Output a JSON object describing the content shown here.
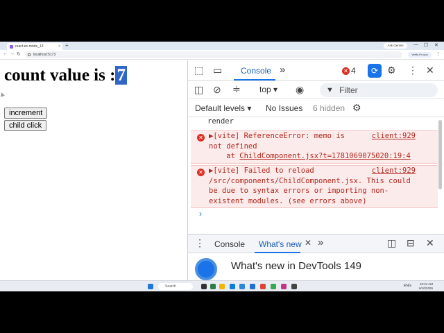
{
  "browser": {
    "tab_title": "react-ex-mode_13",
    "tab_close": "×",
    "new_tab": "+",
    "url": "localhost:5173",
    "ask_label": "Ask Gemini",
    "verify_label": "Verify it's you",
    "win_min": "—",
    "win_max": "☐",
    "win_close": "✕",
    "nav_back": "←",
    "nav_fwd": "→",
    "nav_reload": "↻",
    "menu": "⋮"
  },
  "page": {
    "count_prefix": "count value is :",
    "count_value": "7",
    "increment_label": "increment",
    "child_click_label": "child click"
  },
  "devtools": {
    "tabs": {
      "console": "Console",
      "more": "»"
    },
    "error_count": "4",
    "filter_top": "top",
    "filter_placeholder": "Filter",
    "levels": {
      "default_levels": "Default levels",
      "no_issues": "No Issues",
      "hidden": "6 hidden"
    },
    "console_messages": [
      {
        "text": "render"
      },
      {
        "line1": "▶[vite] ReferenceError: memo is",
        "line2": "not defined",
        "line3_prefix": "    at ",
        "line3_link": "ChildComponent.jsx?t=1781069075020:19:4",
        "source": "client:929"
      },
      {
        "line1": "▶[vite] Failed to reload",
        "line2": "/src/components/ChildComponent.jsx. This could",
        "line3": "be due to syntax errors or importing non-",
        "line4": "existent modules. (see errors above)",
        "source": "client:929"
      }
    ],
    "prompt": "›",
    "drawer": {
      "tab_console": "Console",
      "tab_whats_new": "What's new",
      "whats_new_title": "What's new in DevTools 149"
    }
  },
  "taskbar": {
    "search_label": "Search",
    "time": "10:24 AM",
    "date": "6/10/2026",
    "sys": "ENG"
  },
  "colors": {
    "accent": "#1a73e8",
    "error": "#d93025",
    "error_bg": "#fcebeb",
    "highlight": "#2f66c7"
  }
}
